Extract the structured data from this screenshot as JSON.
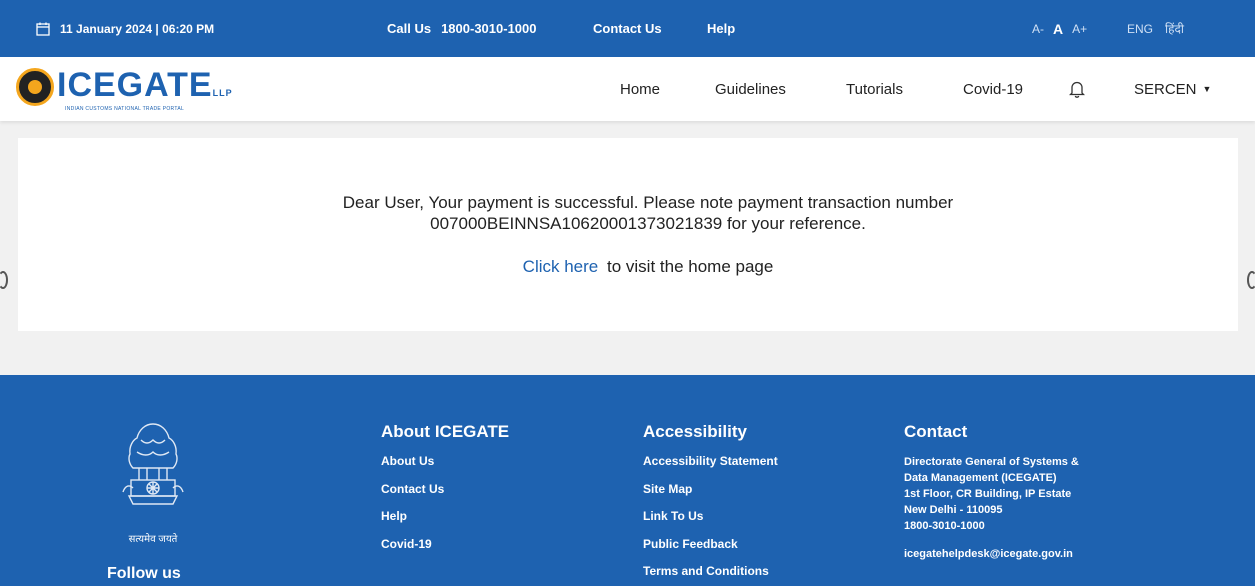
{
  "topbar": {
    "datetime": "11 January 2024 | 06:20 PM",
    "call_label": "Call Us",
    "call_number": "1800-3010-1000",
    "contact_label": "Contact Us",
    "help_label": "Help",
    "font_small": "A-",
    "font_normal": "A",
    "font_large": "A+",
    "lang_en": "ENG",
    "lang_hi": "हिंदी"
  },
  "logo": {
    "wordmark": "ICEGATE",
    "trademark": "LLP",
    "tagline": "INDIAN CUSTOMS NATIONAL TRADE PORTAL"
  },
  "nav": {
    "home": "Home",
    "guidelines": "Guidelines",
    "tutorials": "Tutorials",
    "covid": "Covid-19",
    "user": "SERCEN"
  },
  "main": {
    "message_line1": "Dear User, Your payment is successful. Please note payment transaction number",
    "message_line2": "007000BEINNSA10620001373021839 for your reference.",
    "link_text": "Click here",
    "link_suffix": "to visit the home page"
  },
  "footer": {
    "motto": "सत्यमेव जयते",
    "follow_us": "Follow us",
    "about": {
      "title": "About ICEGATE",
      "items": [
        "About Us",
        "Contact Us",
        "Help",
        "Covid-19"
      ]
    },
    "accessibility": {
      "title": "Accessibility",
      "items": [
        "Accessibility Statement",
        "Site Map",
        "Link To Us",
        "Public Feedback",
        "Terms and Conditions"
      ]
    },
    "contact": {
      "title": "Contact",
      "lines": [
        "Directorate General of Systems &",
        "Data Management (ICEGATE)",
        "1st Floor, CR Building, IP Estate",
        "New Delhi - 110095",
        "1800-3010-1000"
      ],
      "email": "icegatehelpdesk@icegate.gov.in"
    }
  },
  "colors": {
    "brand_blue": "#1e62b0",
    "logo_orange": "#f4a61d",
    "page_bg": "#f1f1f1"
  }
}
